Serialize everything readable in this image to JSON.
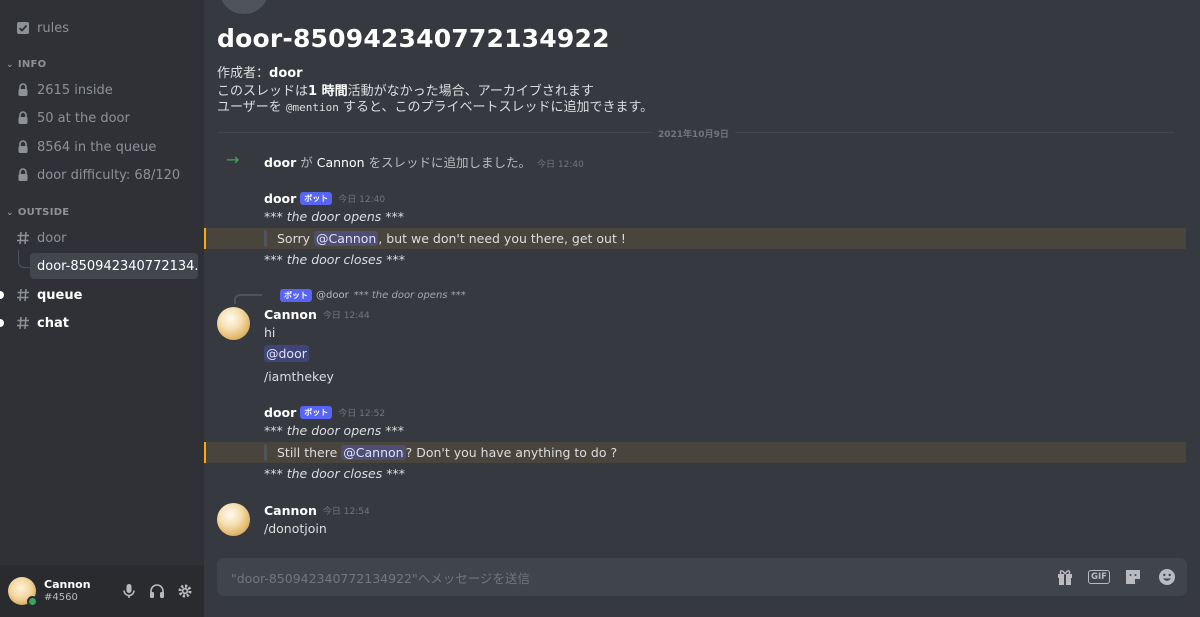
{
  "sidebar": {
    "channels_top": [
      {
        "label": "rules",
        "icon": "rules-check-icon"
      }
    ],
    "categories": {
      "info": "INFO",
      "outside": "OUTSIDE"
    },
    "info_channels": [
      {
        "label": "2615 inside",
        "icon": "lock-icon"
      },
      {
        "label": "50 at the door",
        "icon": "lock-icon"
      },
      {
        "label": "8564 in the queue",
        "icon": "lock-icon"
      },
      {
        "label": "door difficulty: 68/120",
        "icon": "lock-icon"
      }
    ],
    "outside_channels": [
      {
        "label": "door",
        "icon": "hash-icon"
      },
      {
        "label": "door-850942340772134...",
        "icon": "thread-icon",
        "selected": true
      },
      {
        "label": "queue",
        "icon": "hash-icon",
        "unread": true
      },
      {
        "label": "chat",
        "icon": "hash-icon",
        "unread": true
      }
    ],
    "user": {
      "name": "Cannon",
      "tag": "#4560",
      "status_color": "#3ba55d"
    }
  },
  "thread": {
    "title": "door-850942340772134922",
    "creator_label": "作成者：",
    "creator": "door",
    "archive_prefix": "このスレッドは",
    "archive_bold": "1 時間",
    "archive_suffix": "活動がなかった場合、アーカイブされます",
    "mention_prefix": "ユーザーを ",
    "mention_code": "@mention",
    "mention_suffix": " すると、このプライベートスレッドに追加できます。"
  },
  "date_divider": "2021年10月9日",
  "messages": {
    "system": {
      "actor": "door",
      "mid1": " が ",
      "target": "Cannon",
      "mid2": " をスレッドに追加しました。",
      "time": "今日 12:40"
    },
    "m1": {
      "author": "door",
      "badge": "ボット",
      "time": "今日 12:40",
      "line1": "*** the door opens ***",
      "quote_pre": "Sorry ",
      "quote_mention": "@Cannon",
      "quote_post": ", but we don't need you there, get out !",
      "line3": "*** the door closes ***"
    },
    "m2": {
      "reply_badge": "ボット",
      "reply_author": "@door",
      "reply_text": "*** the door opens ***",
      "author": "Cannon",
      "time": "今日 12:44",
      "line1": "hi",
      "mention": "@door",
      "line3": "/iamthekey"
    },
    "m3": {
      "author": "door",
      "badge": "ボット",
      "time": "今日 12:52",
      "line1": "*** the door opens ***",
      "quote_pre": "Still there ",
      "quote_mention": "@Cannon",
      "quote_post": " ? Don't you have anything to do ?",
      "line3": "*** the door closes ***"
    },
    "m4": {
      "author": "Cannon",
      "time": "今日 12:54",
      "line1": "/donotjoin"
    }
  },
  "composer": {
    "placeholder": "\"door-850942340772134922\"へメッセージを送信",
    "gif_label": "GIF"
  },
  "colors": {
    "accent": "#5865f2",
    "highlight_border": "#faa81a",
    "online": "#3ba55d"
  }
}
